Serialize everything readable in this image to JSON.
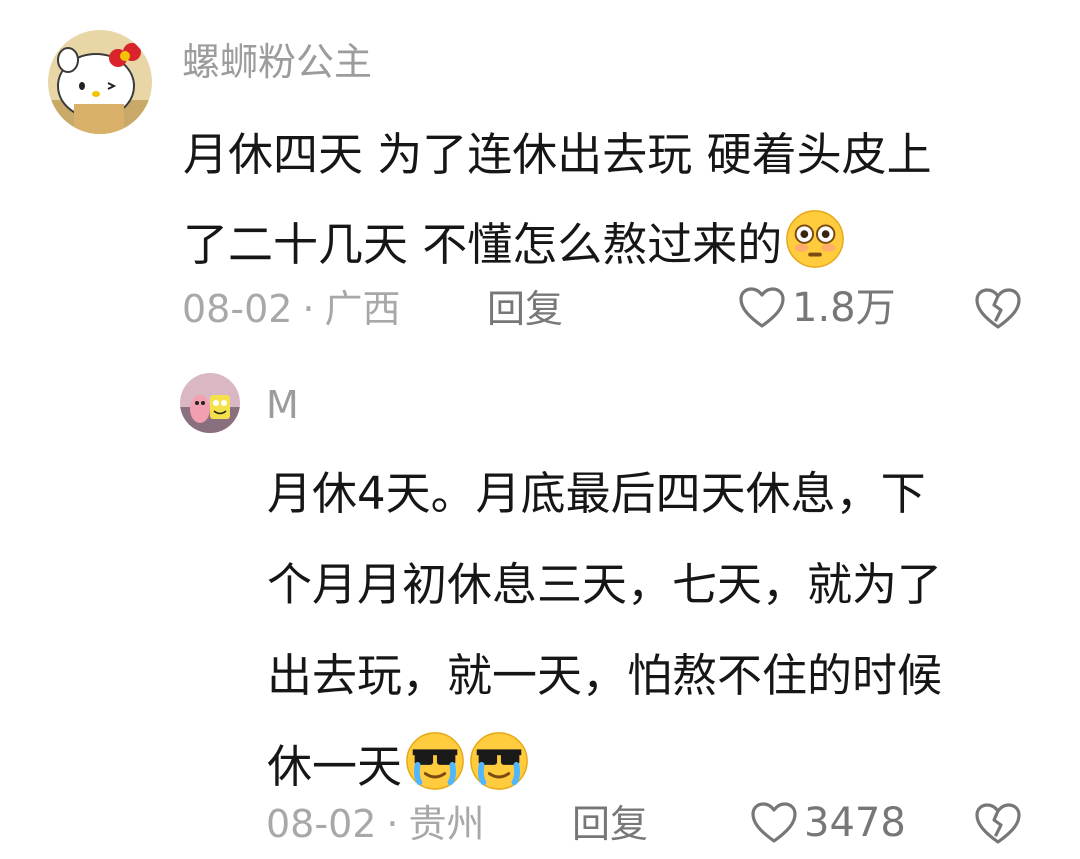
{
  "comment": {
    "username": "螺蛳粉公主",
    "avatar_icon": "hello-kitty-avatar",
    "lines": [
      "月休四天 为了连休出去玩 硬着头皮上",
      "了二十几天 不懂怎么熬过来的"
    ],
    "emoji": "flushed-face-emoji",
    "date": "08-02",
    "separator": "·",
    "location": "广西",
    "reply_label": "回复",
    "like_count": "1.8万"
  },
  "reply": {
    "username": "M",
    "avatar_icon": "patrick-spongebob-avatar",
    "lines": [
      "月休4天。月底最后四天休息，下",
      "个月月初休息三天，七天，就为了",
      "出去玩，就一天，怕熬不住的时候",
      "休一天"
    ],
    "emoji": "crying-sunglasses-emoji",
    "date": "08-02",
    "separator": "·",
    "location": "贵州",
    "reply_label": "回复",
    "like_count": "3478"
  },
  "colors": {
    "text": "#161616",
    "muted": "#9c9c9c",
    "icon": "#777777"
  }
}
